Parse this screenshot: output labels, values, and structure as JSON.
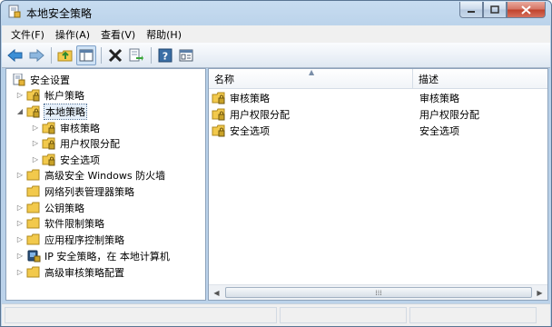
{
  "window": {
    "title": "本地安全策略"
  },
  "menu": [
    {
      "id": "file",
      "label": "文件(F)"
    },
    {
      "id": "action",
      "label": "操作(A)"
    },
    {
      "id": "view",
      "label": "查看(V)"
    },
    {
      "id": "help",
      "label": "帮助(H)"
    }
  ],
  "toolbar": {
    "buttons": [
      "back-arrow-icon",
      "forward-arrow-icon",
      "up-folder-icon",
      "show-hide-tree-icon",
      "delete-icon",
      "export-list-icon",
      "help-icon",
      "properties-icon"
    ]
  },
  "tree": {
    "root": "安全设置",
    "items": [
      {
        "label": "帐户策略",
        "expander": "▷",
        "icon": "folder-lock-icon"
      },
      {
        "label": "本地策略",
        "expander": "◢",
        "icon": "folder-lock-icon",
        "selected": true
      },
      {
        "label": "审核策略",
        "expander": "▷",
        "icon": "folder-lock-icon"
      },
      {
        "label": "用户权限分配",
        "expander": "▷",
        "icon": "folder-lock-icon"
      },
      {
        "label": "安全选项",
        "expander": "▷",
        "icon": "folder-lock-icon"
      },
      {
        "label": "高级安全 Windows 防火墙",
        "expander": "▷",
        "icon": "folder-icon"
      },
      {
        "label": "网络列表管理器策略",
        "expander": "",
        "icon": "folder-icon"
      },
      {
        "label": "公钥策略",
        "expander": "▷",
        "icon": "folder-icon"
      },
      {
        "label": "软件限制策略",
        "expander": "▷",
        "icon": "folder-icon"
      },
      {
        "label": "应用程序控制策略",
        "expander": "▷",
        "icon": "folder-icon"
      },
      {
        "label": "IP 安全策略，在 本地计算机",
        "expander": "▷",
        "icon": "ip-security-icon"
      },
      {
        "label": "高级审核策略配置",
        "expander": "▷",
        "icon": "folder-icon"
      }
    ]
  },
  "list": {
    "columns": {
      "name": "名称",
      "description": "描述"
    },
    "rows": [
      {
        "name": "审核策略",
        "description": "审核策略"
      },
      {
        "name": "用户权限分配",
        "description": "用户权限分配"
      },
      {
        "name": "安全选项",
        "description": "安全选项"
      }
    ]
  },
  "colors": {
    "accent": "#3a6ea5",
    "folder": "#f2c94c",
    "lock": "#c9a227"
  }
}
